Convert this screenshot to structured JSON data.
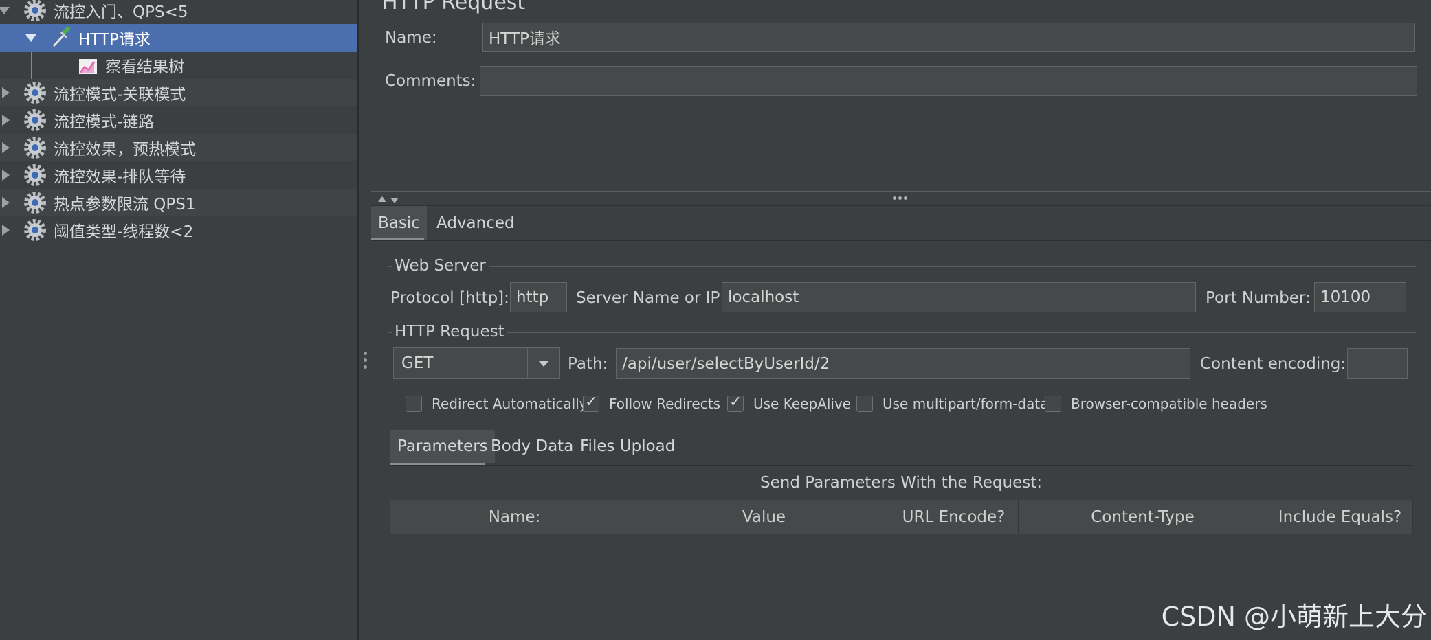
{
  "tree": {
    "items": [
      {
        "label": "流控入门、QPS<5",
        "expanded": true,
        "icon": "gear-icon"
      },
      {
        "label": "HTTP请求",
        "expanded": true,
        "icon": "pipette-icon",
        "selected": true
      },
      {
        "label": "察看结果树",
        "icon": "chart-icon"
      },
      {
        "label": "流控模式-关联模式",
        "expanded": false,
        "icon": "gear-icon"
      },
      {
        "label": "流控模式-链路",
        "expanded": false,
        "icon": "gear-icon"
      },
      {
        "label": "流控效果，预热模式",
        "expanded": false,
        "icon": "gear-icon"
      },
      {
        "label": "流控效果-排队等待",
        "expanded": false,
        "icon": "gear-icon"
      },
      {
        "label": "热点参数限流 QPS1",
        "expanded": false,
        "icon": "gear-icon"
      },
      {
        "label": "阈值类型-线程数<2",
        "expanded": false,
        "icon": "gear-icon"
      }
    ]
  },
  "panel": {
    "title": "HTTP Request",
    "name_label": "Name:",
    "name_value": "HTTP请求",
    "comments_label": "Comments:",
    "comments_value": ""
  },
  "tabs": {
    "basic": "Basic",
    "advanced": "Advanced"
  },
  "web_server": {
    "title": "Web Server",
    "protocol_label": "Protocol [http]:",
    "protocol_value": "http",
    "server_label": "Server Name or IP:",
    "server_value": "localhost",
    "port_label": "Port Number:",
    "port_value": "10100"
  },
  "http_request": {
    "title": "HTTP Request",
    "method": "GET",
    "path_label": "Path:",
    "path_value": "/api/user/selectByUserId/2",
    "encoding_label": "Content encoding:",
    "encoding_value": ""
  },
  "options": [
    {
      "label": "Redirect Automatically",
      "checked": false
    },
    {
      "label": "Follow Redirects",
      "checked": true
    },
    {
      "label": "Use KeepAlive",
      "checked": true
    },
    {
      "label": "Use multipart/form-data",
      "checked": false
    },
    {
      "label": "Browser-compatible headers",
      "checked": false
    }
  ],
  "sub_tabs": {
    "parameters": "Parameters",
    "body_data": "Body Data",
    "files_upload": "Files Upload"
  },
  "params": {
    "caption": "Send Parameters With the Request:",
    "columns": [
      "Name:",
      "Value",
      "URL Encode?",
      "Content-Type",
      "Include Equals?"
    ]
  },
  "watermark": "CSDN @小萌新上大分",
  "colors": {
    "background": "#3c3f41",
    "selection": "#4b6eaf",
    "field": "#45494a"
  }
}
